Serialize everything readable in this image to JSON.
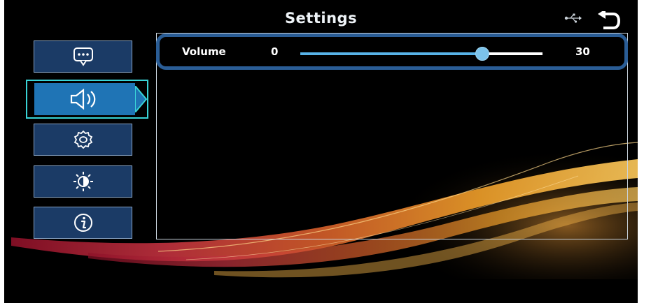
{
  "header": {
    "title": "Settings",
    "usb_icon": "usb-icon",
    "back_icon": "back-arrow-icon"
  },
  "sidebar": {
    "items": [
      {
        "name": "message",
        "icon": "message-icon",
        "active": false
      },
      {
        "name": "volume",
        "icon": "speaker-icon",
        "active": true
      },
      {
        "name": "general",
        "icon": "gear-icon",
        "active": false
      },
      {
        "name": "brightness",
        "icon": "brightness-icon",
        "active": false
      },
      {
        "name": "info",
        "icon": "info-icon",
        "active": false
      }
    ]
  },
  "volume": {
    "label": "Volume",
    "min_label": "0",
    "max_label": "30",
    "fraction": 0.75
  },
  "colors": {
    "accent": "#1f74b5",
    "active_outline": "#39d3d6",
    "slider_fill": "#58b3e8",
    "row_highlight": "#2a5d96"
  }
}
